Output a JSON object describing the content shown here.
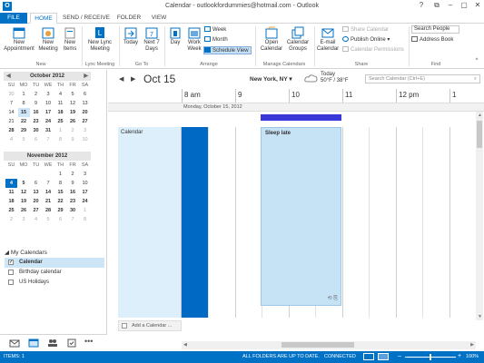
{
  "window": {
    "title": "Calendar - outlookfordummies@hotmail.com - Outlook",
    "controls": [
      "?",
      "⧉",
      "–",
      "▢",
      "✕"
    ]
  },
  "tabs": [
    {
      "label": "FILE"
    },
    {
      "label": "HOME"
    },
    {
      "label": "SEND / RECEIVE"
    },
    {
      "label": "FOLDER"
    },
    {
      "label": "VIEW"
    }
  ],
  "ribbon": {
    "new_appointment": "New Appointment",
    "new_meeting": "New Meeting",
    "new_items": "New Items",
    "new_lync_meeting": "New Lync Meeting",
    "today": "Today",
    "next7": "Next 7 Days",
    "day": "Day",
    "work_week": "Work Week",
    "week": "Week",
    "month": "Month",
    "schedule_view": "Schedule View",
    "open_calendar": "Open Calendar",
    "calendar_groups": "Calendar Groups",
    "email_calendar": "E-mail Calendar",
    "share_calendar": "Share Calendar",
    "publish_online": "Publish Online",
    "calendar_permissions": "Calendar Permissions",
    "search_people": "Search People",
    "address_book": "Address Book",
    "groups": {
      "new": "New",
      "lync": "Lync Meeting",
      "goto": "Go To",
      "arrange": "Arrange",
      "manage": "Manage Calendars",
      "share": "Share",
      "find": "Find"
    }
  },
  "mini_calendars": [
    {
      "month": "October 2012",
      "dow": [
        "SU",
        "MO",
        "TU",
        "WE",
        "TH",
        "FR",
        "SA"
      ],
      "weeks": [
        [
          "30",
          "1",
          "2",
          "3",
          "4",
          "5",
          "6"
        ],
        [
          "7",
          "8",
          "9",
          "10",
          "11",
          "12",
          "13"
        ],
        [
          "14",
          "15",
          "16",
          "17",
          "18",
          "19",
          "20"
        ],
        [
          "21",
          "22",
          "23",
          "24",
          "25",
          "26",
          "27"
        ],
        [
          "28",
          "29",
          "30",
          "31",
          "1",
          "2",
          "3"
        ],
        [
          "4",
          "5",
          "6",
          "7",
          "8",
          "9",
          "10"
        ]
      ]
    },
    {
      "month": "November 2012",
      "dow": [
        "SU",
        "MO",
        "TU",
        "WE",
        "TH",
        "FR",
        "SA"
      ],
      "weeks": [
        [
          "",
          "",
          "",
          "",
          "1",
          "2",
          "3"
        ],
        [
          "4",
          "5",
          "6",
          "7",
          "8",
          "9",
          "10"
        ],
        [
          "11",
          "12",
          "13",
          "14",
          "15",
          "16",
          "17"
        ],
        [
          "18",
          "19",
          "20",
          "21",
          "22",
          "23",
          "24"
        ],
        [
          "25",
          "26",
          "27",
          "28",
          "29",
          "30",
          "1"
        ],
        [
          "2",
          "3",
          "4",
          "5",
          "6",
          "7",
          "8"
        ]
      ]
    }
  ],
  "my_calendars": {
    "header": "My Calendars",
    "items": [
      {
        "label": "Calendar",
        "checked": "✓"
      },
      {
        "label": "Birthday calendar",
        "checked": ""
      },
      {
        "label": "US Holidays",
        "checked": ""
      }
    ]
  },
  "calview": {
    "date_title": "Oct 15",
    "location": "New York, NY",
    "weather_label": "Today",
    "weather_temp": "50°F / 38°F",
    "search_placeholder": "Search Calendar (Ctrl+E)",
    "times": [
      "8 am",
      "9",
      "10",
      "11",
      "12 pm",
      "1"
    ],
    "date_row": "Monday, October 15, 2012",
    "calendar_label": "Calendar",
    "appointment_title": "Sleep late",
    "appointment_icons": "⟲ ⎘",
    "add_calendar": "Add a Calendar ..."
  },
  "status": {
    "items": "ITEMS: 1",
    "folders": "ALL FOLDERS ARE UP TO DATE.",
    "connected": "CONNECTED",
    "zoom": "100%"
  },
  "colors": {
    "accent": "#0072c6",
    "allday_bar": "#3838d8",
    "appointment": "#c6e2f5",
    "busy_bar": "#0069c4"
  }
}
